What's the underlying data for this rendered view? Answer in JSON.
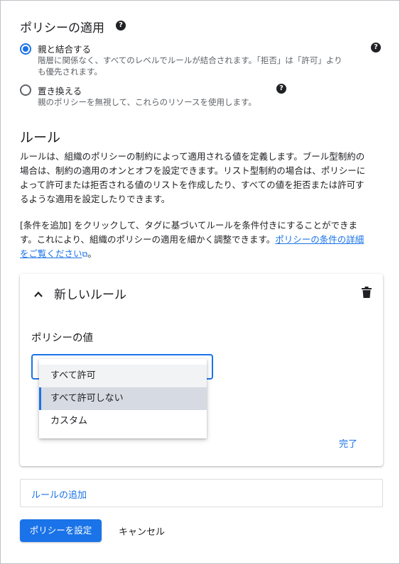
{
  "policy": {
    "title": "ポリシーの適用",
    "options": [
      {
        "label": "親と結合する",
        "description_line1": "階層に関係なく、すべてのレベルでルールが結合されます。「拒否」は「許可」より",
        "description_line2": "も優先されます。",
        "checked": true
      },
      {
        "label": "置き換える",
        "description_line1": "親のポリシーを無視して、これらのリソースを使用します。",
        "checked": false
      }
    ],
    "help_icon_glyph": "?"
  },
  "rules": {
    "title": "ルール",
    "para1": [
      "ルールは、組織のポリシーの制約によって適用される値を定義します。ブール型制約の",
      "場合は、制約の適用のオンとオフを設定できます。リスト型制約の場合は、ポリシーに",
      "よって許可または拒否される値のリストを作成したり、すべての値を拒否または許可す",
      "るような適用を設定したりできます。"
    ],
    "para2_line1": "[条件を追加] をクリックして、タグに基づいてルールを条件付きにすることができま",
    "para2_line2_prefix": "す。これにより、組織のポリシーの適用を細かく調整できます。",
    "para2_link_part1": "ポリシーの条件の詳細",
    "para2_link_part2": "をご覧ください",
    "para2_suffix": "。",
    "external_link_glyph": "⧉"
  },
  "rule_card": {
    "title": "新しいルール",
    "field_label": "ポリシーの値",
    "dropdown_options": [
      "すべて許可",
      "すべて許可しない",
      "カスタム"
    ],
    "highlighted_option": "すべて許可しない",
    "done_label": "完了"
  },
  "add_rule_label": "ルールの追加",
  "buttons": {
    "set_policy": "ポリシーを設定",
    "cancel": "キャンセル"
  },
  "colors": {
    "accent": "#1a73e8",
    "text": "#202124",
    "secondary_text": "#5f6368"
  },
  "icons": [
    "help-icon",
    "radio-checked-icon",
    "radio-unchecked-icon",
    "external-link-icon",
    "chevron-up-icon",
    "trash-icon"
  ]
}
